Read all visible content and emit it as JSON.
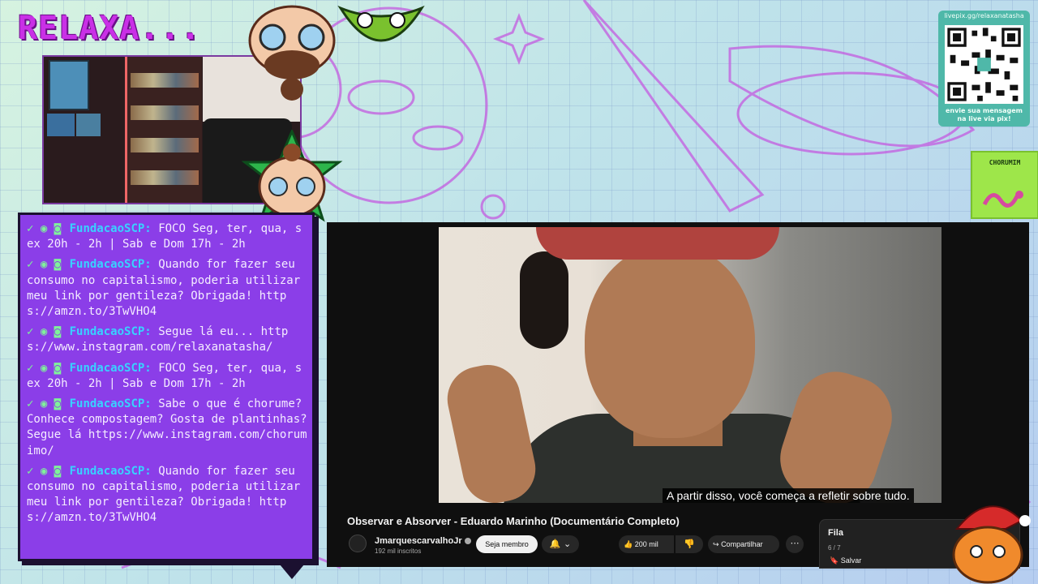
{
  "stream": {
    "title": "RELAXA..."
  },
  "chat": {
    "messages": [
      {
        "badges": "✓ ◉ ◙",
        "user": "FundacaoSCP:",
        "text": "FOCO Seg, ter, qua, sex 20h - 2h | Sab e Dom 17h - 2h"
      },
      {
        "badges": "✓ ◉ ◙",
        "user": "FundacaoSCP:",
        "text": "Quando for fazer seu consumo no capitalismo, poderia utilizar meu link por gentileza? Obrigada! https://amzn.to/3TwVHO4"
      },
      {
        "badges": "✓ ◉ ◙",
        "user": "FundacaoSCP:",
        "text": "Segue lá eu... https://www.instagram.com/relaxanatasha/"
      },
      {
        "badges": "✓ ◉ ◙",
        "user": "FundacaoSCP:",
        "text": "FOCO Seg, ter, qua, sex 20h - 2h | Sab e Dom 17h - 2h"
      },
      {
        "badges": "✓ ◉ ◙",
        "user": "FundacaoSCP:",
        "text": "Sabe o que é chorume? Conhece compostagem? Gosta de plantinhas? Segue lá https://www.instagram.com/chorumimo/"
      },
      {
        "badges": "✓ ◉ ◙",
        "user": "FundacaoSCP:",
        "text": "Quando for fazer seu consumo no capitalismo, poderia utilizar meu link por gentileza? Obrigada! https://amzn.to/3TwVHO4"
      }
    ]
  },
  "video": {
    "subtitle": "A partir disso, você começa a refletir sobre tudo.",
    "title": "Observar e Absorver - Eduardo Marinho (Documentário Completo)",
    "channel": "JmarquescarvalhoJr",
    "subscribers": "192 mil inscritos",
    "member_label": "Seja membro",
    "bell_label": "🔔 ⌄",
    "likes": "200 mil",
    "like_icon": "👍",
    "dislike_icon": "👎",
    "share_label": "Compartilhar",
    "share_icon": "↪",
    "more_icon": "⋯"
  },
  "queue": {
    "title": "Fila",
    "count": "6 / 7",
    "save_label": "Salvar",
    "save_icon": "🔖"
  },
  "qr": {
    "url": "livepix.gg/relaxanatasha",
    "caption": "envie sua mensagem na live via pix!"
  },
  "logo": {
    "text": "CHORUMIM"
  }
}
